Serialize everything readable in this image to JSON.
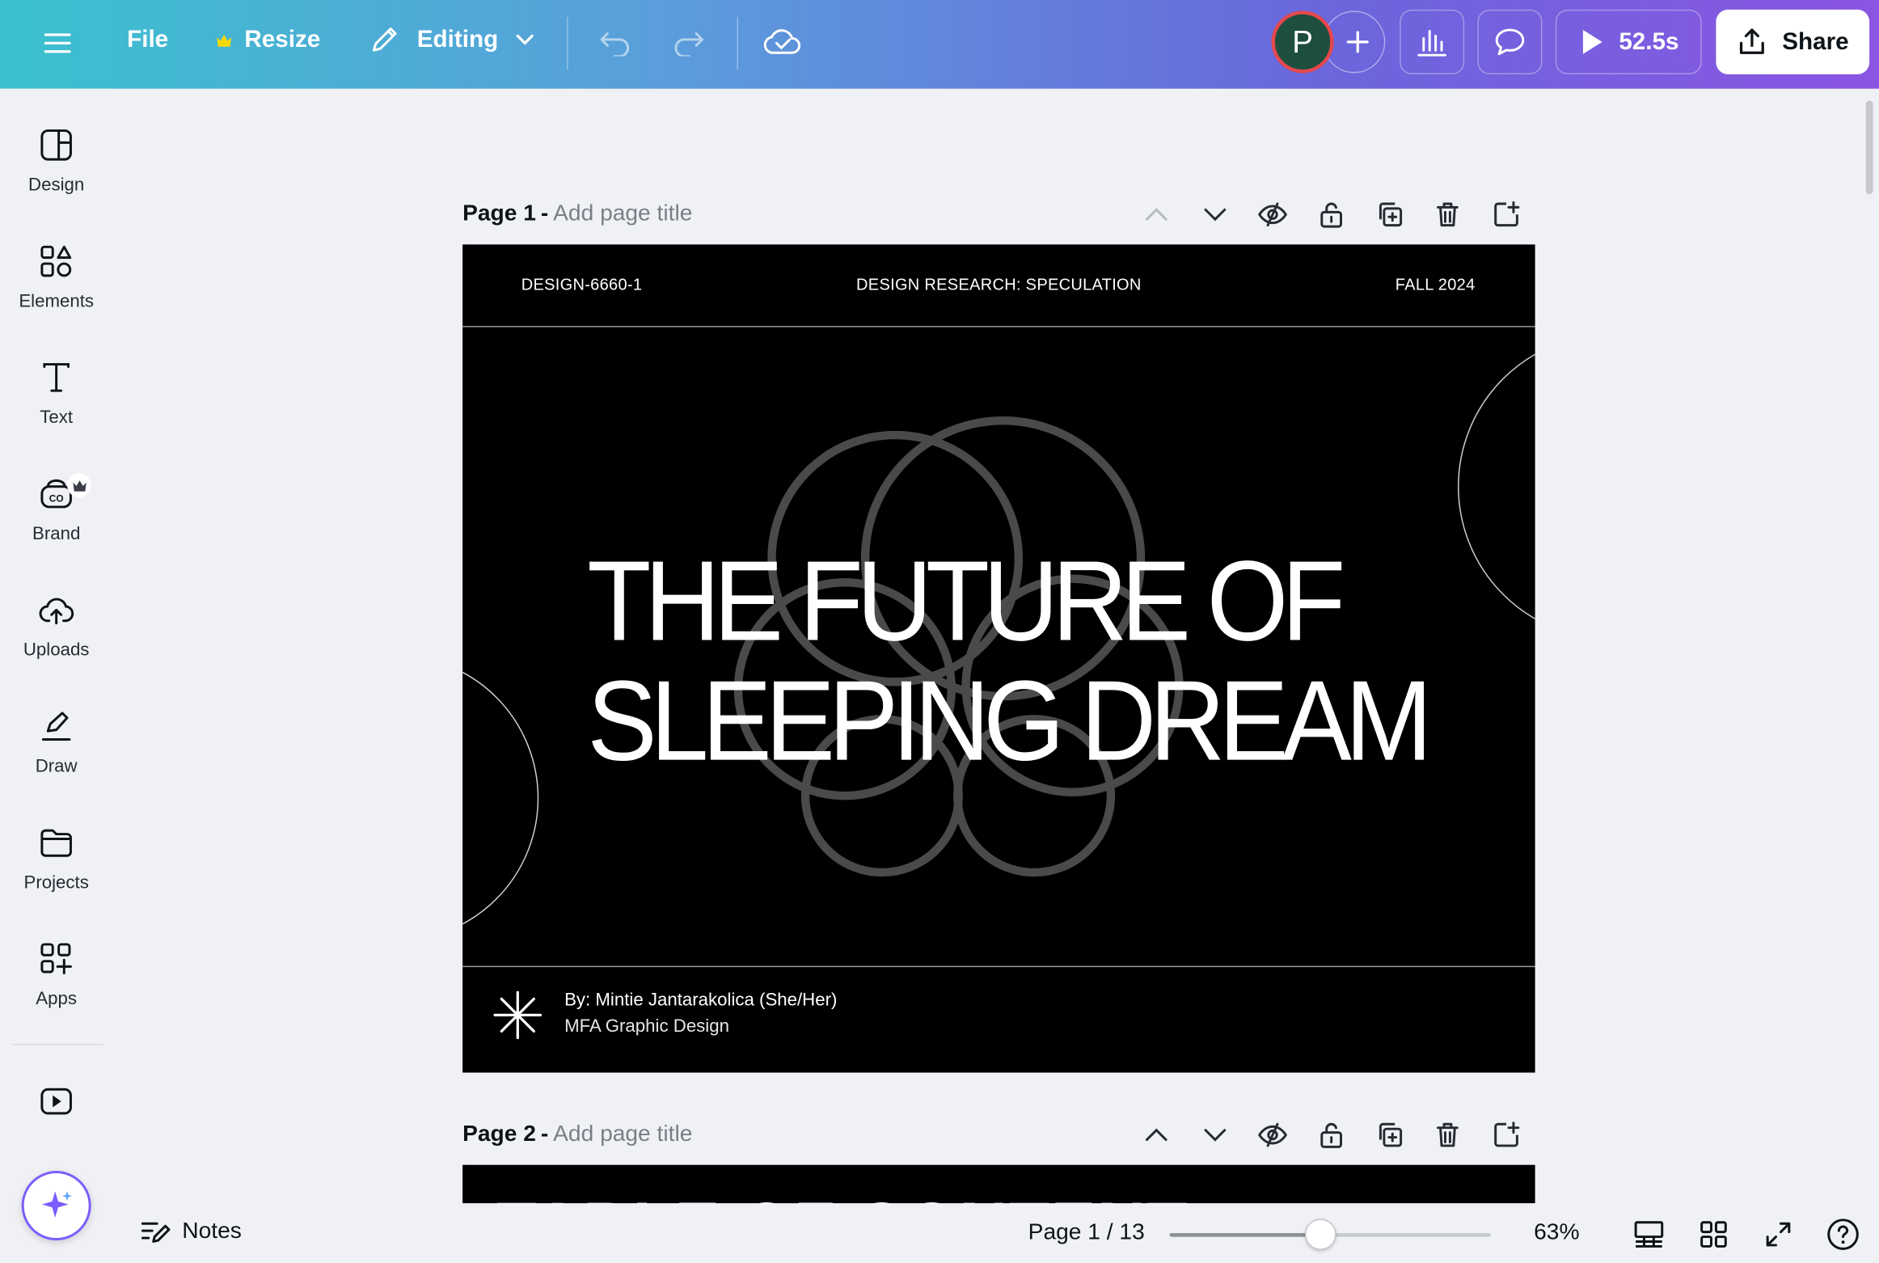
{
  "topbar": {
    "menu_icon": "hamburger-icon",
    "file_label": "File",
    "resize_label": "Resize",
    "editing_label": "Editing",
    "avatar_initial": "P",
    "timer_label": "52.5s",
    "share_label": "Share",
    "gradient_colors": [
      "#3bc1ce",
      "#6a67dc",
      "#8a55e2"
    ]
  },
  "sidebar": {
    "items": [
      {
        "label": "Design",
        "icon": "layout-icon"
      },
      {
        "label": "Elements",
        "icon": "shapes-icon"
      },
      {
        "label": "Text",
        "icon": "text-icon"
      },
      {
        "label": "Brand",
        "icon": "brand-icon"
      },
      {
        "label": "Uploads",
        "icon": "cloud-upload-icon"
      },
      {
        "label": "Draw",
        "icon": "pen-icon"
      },
      {
        "label": "Projects",
        "icon": "folder-icon"
      },
      {
        "label": "Apps",
        "icon": "apps-icon"
      }
    ],
    "video_icon": "video-icon",
    "magic_icon": "sparkle-icon"
  },
  "pages": [
    {
      "number": "Page 1",
      "title_placeholder": "Add page title"
    },
    {
      "number": "Page 2",
      "title_placeholder": "Add page title"
    }
  ],
  "slide1": {
    "course_code": "DESIGN-6660-1",
    "course_name": "DESIGN RESEARCH: SPECULATION",
    "term": "FALL 2024",
    "title_line1": "THE FUTURE OF",
    "title_line2": "SLEEPING DREAM",
    "author": "By: Mintie Jantarakolica (She/Her)",
    "program": "MFA Graphic Design"
  },
  "slide2": {
    "title_partial": "TABLE OF CONTENT"
  },
  "bottombar": {
    "notes_label": "Notes",
    "page_indicator": "Page 1 / 13",
    "zoom_label": "63%",
    "zoom_fraction": 0.47
  }
}
